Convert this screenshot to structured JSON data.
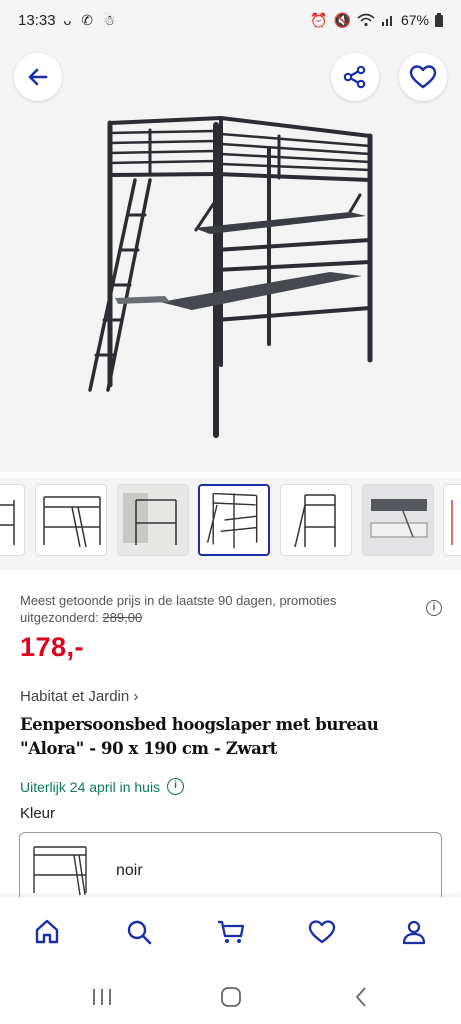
{
  "status_bar": {
    "time": "13:33",
    "left_icons": "ᴗ ✆ ☃",
    "battery": "67%"
  },
  "gallery": {
    "thumbnail_count": 7,
    "active_index": 3
  },
  "price": {
    "note_prefix": "Meest getoonde prijs in de laatste 90 dagen, promoties uitgezonderd: ",
    "old_price": "289,00",
    "current": "178,-"
  },
  "product": {
    "brand": "Habitat et Jardin",
    "title": "Eenpersoonsbed hoogslaper met bureau \"Alora\" - 90 x 190 cm - Zwart",
    "delivery": "Uiterlijk 24 april in huis"
  },
  "color_selector": {
    "label": "Kleur",
    "value": "noir"
  },
  "colors": {
    "accent": "#1a2ea8",
    "price": "#e0001b",
    "delivery": "#0a7a52"
  },
  "icons": {
    "back": "arrow-left-icon",
    "share": "share-icon",
    "favorite": "heart-icon",
    "home": "home-icon",
    "search": "search-icon",
    "cart": "cart-icon",
    "wishlist": "heart-icon",
    "account": "user-icon"
  }
}
